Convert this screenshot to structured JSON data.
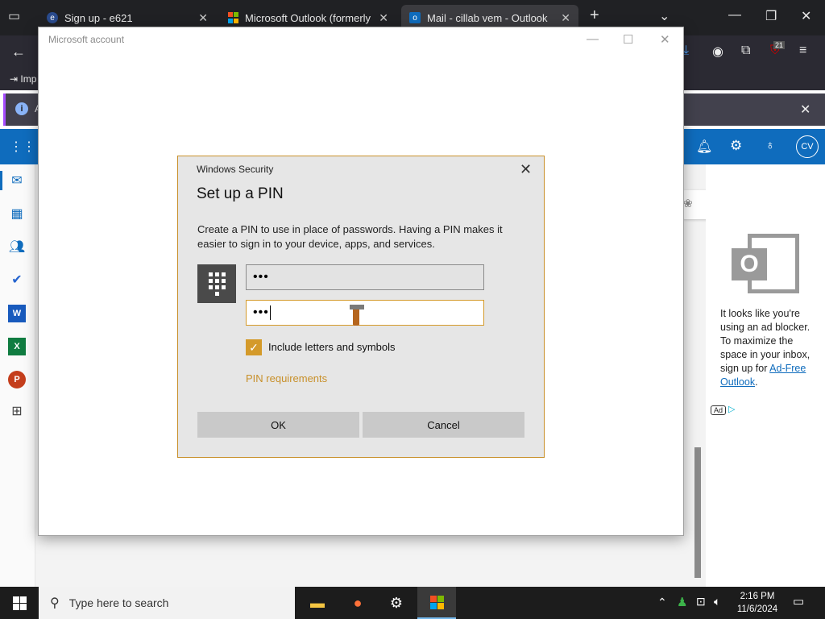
{
  "browser": {
    "tabs": [
      {
        "label": "Sign up - e621",
        "active": false
      },
      {
        "label": "Microsoft Outlook (formerly Ho",
        "active": false
      },
      {
        "label": "Mail - cillab vem - Outlook",
        "active": true
      }
    ],
    "bookmark_partial": "Imp",
    "notification_partial": "A",
    "badge_count": "21"
  },
  "outlook": {
    "avatar_initials": "CV",
    "toolbar_more": "···",
    "ad_text": "It looks like you're using an ad blocker. To maximize the space in your inbox, sign up for",
    "ad_link": "Ad-Free Outlook",
    "ad_link_suffix": ".",
    "ad_badge": "Ad"
  },
  "ms_window": {
    "title": "Microsoft account"
  },
  "dialog": {
    "window_title": "Windows Security",
    "heading": "Set up a PIN",
    "description": "Create a PIN to use in place of passwords. Having a PIN makes it easier to sign in to your device, apps, and services.",
    "pin_value": "•••",
    "confirm_value": "•••",
    "checkbox_label": "Include letters and symbols",
    "checkbox_checked": true,
    "pin_requirements_link": "PIN requirements",
    "ok_label": "OK",
    "cancel_label": "Cancel"
  },
  "taskbar": {
    "search_placeholder": "Type here to search",
    "time": "2:16 PM",
    "date": "11/6/2024"
  },
  "colors": {
    "accent": "#d49a2a",
    "outlook_blue": "#0f6cbd"
  }
}
